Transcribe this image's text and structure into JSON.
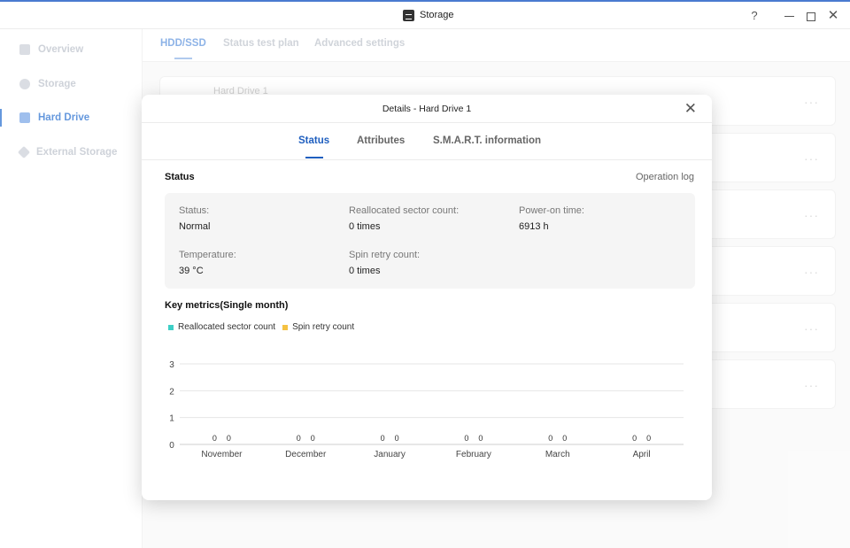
{
  "window": {
    "title": "Storage",
    "help": "?",
    "close": "✕"
  },
  "sidebar": {
    "items": [
      {
        "label": "Overview"
      },
      {
        "label": "Storage"
      },
      {
        "label": "Hard Drive"
      },
      {
        "label": "External Storage"
      }
    ]
  },
  "main": {
    "tabs": [
      "HDD/SSD",
      "Status test plan",
      "Advanced settings"
    ],
    "drive_name": "Hard Drive 1",
    "dots": "···"
  },
  "modal": {
    "title": "Details - Hard Drive 1",
    "close": "✕",
    "tabs": [
      "Status",
      "Attributes",
      "S.M.A.R.T. information"
    ],
    "status_title": "Status",
    "operation_log": "Operation log",
    "fields": {
      "status_label": "Status:",
      "status_value": "Normal",
      "realloc_label": "Reallocated sector count:",
      "realloc_value": "0 times",
      "poweron_label": "Power-on time:",
      "poweron_value": "6913 h",
      "temp_label": "Temperature:",
      "temp_value": "39 °C",
      "spin_label": "Spin retry count:",
      "spin_value": "0 times"
    },
    "metrics_title": "Key metrics(Single month)"
  },
  "chart_data": {
    "type": "bar",
    "categories": [
      "November",
      "December",
      "January",
      "February",
      "March",
      "April"
    ],
    "series": [
      {
        "name": "Reallocated sector count",
        "color": "#3ecfc6",
        "values": [
          0,
          0,
          0,
          0,
          0,
          0
        ]
      },
      {
        "name": "Spin retry count",
        "color": "#f5c242",
        "values": [
          0,
          0,
          0,
          0,
          0,
          0
        ]
      }
    ],
    "yticks": [
      "0",
      "1",
      "2",
      "3"
    ],
    "ylim": [
      0,
      3
    ],
    "grid": true,
    "legend": "top-left",
    "data_labels": true
  }
}
